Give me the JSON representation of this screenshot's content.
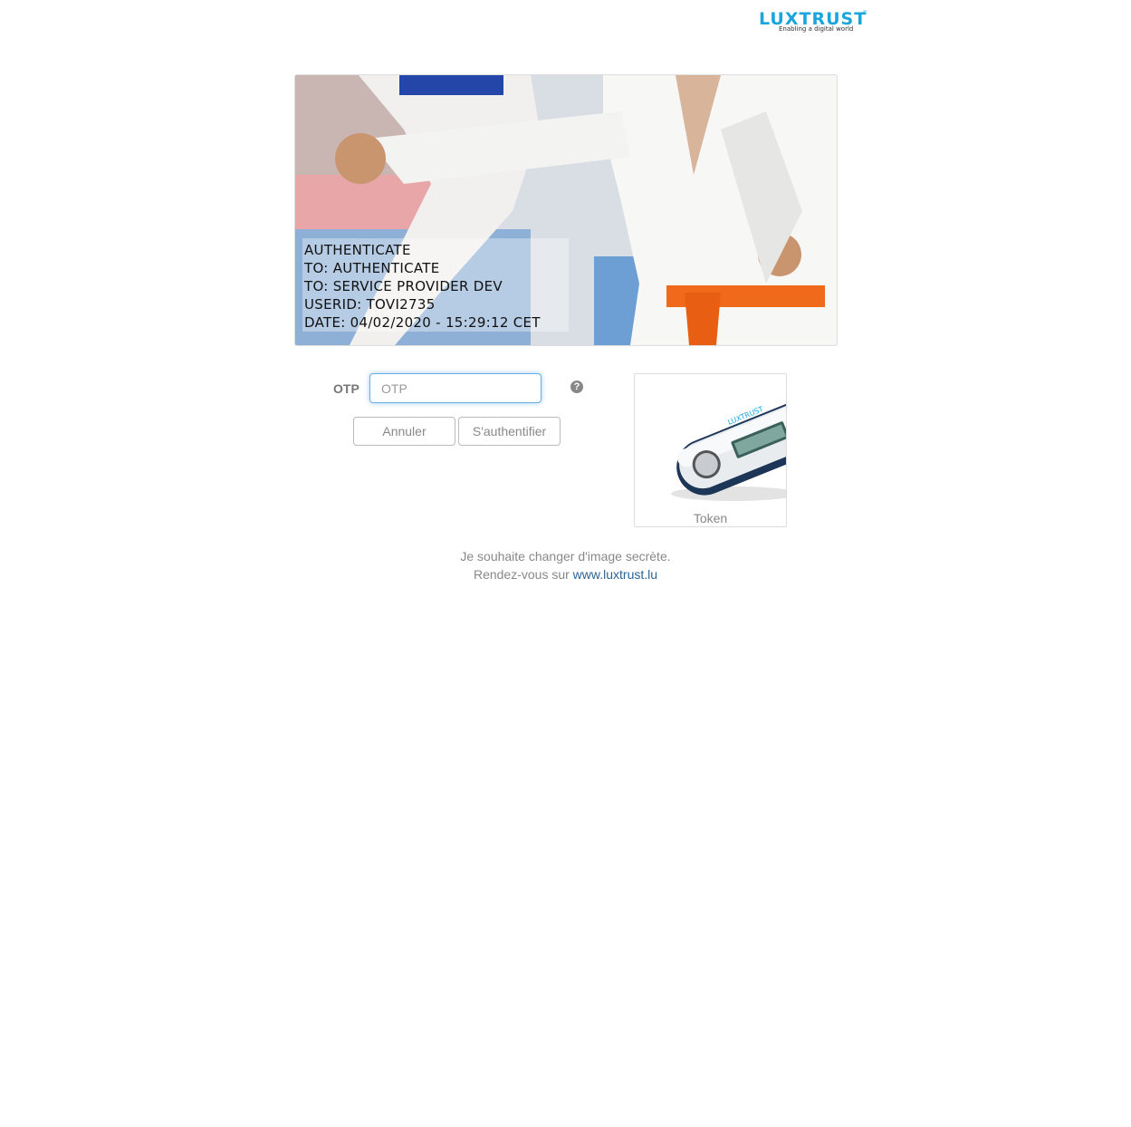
{
  "brand": {
    "logo_text": "LUXTRUST",
    "tagline": "Enabling a digital world"
  },
  "secret_image": {
    "lines": [
      "AUTHENTICATE",
      "TO: AUTHENTICATE",
      "TO: SERVICE PROVIDER DEV",
      "USERID: TOVI2735",
      "DATE: 04/02/2020 - 15:29:12 CET"
    ]
  },
  "form": {
    "otp_label": "OTP",
    "otp_placeholder": "OTP",
    "otp_value": "",
    "help_icon": "question-circle-icon",
    "cancel_label": "Annuler",
    "authenticate_label": "S'authentifier"
  },
  "device": {
    "label": "Token",
    "brand_on_device": "LUXTRUST"
  },
  "footer": {
    "line1": "Je souhaite changer d'image secrète.",
    "line2_prefix": "Rendez-vous sur",
    "link_text": "www.luxtrust.lu"
  },
  "colors": {
    "brand_blue": "#1aa6dc",
    "link": "#2a6496",
    "input_focus": "#66afe9",
    "belt_orange": "#f06a1c"
  }
}
